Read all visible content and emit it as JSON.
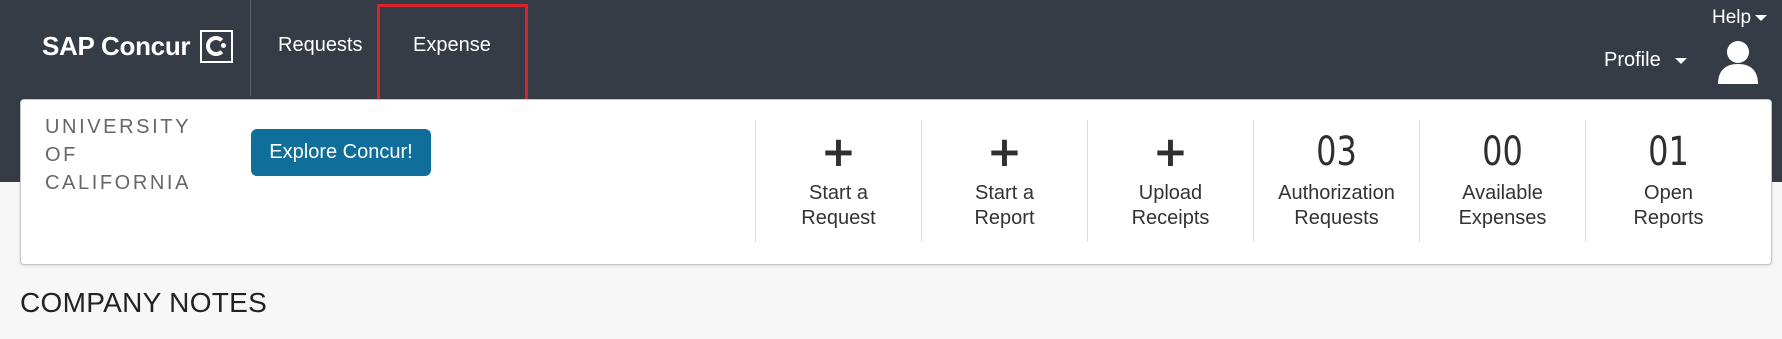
{
  "header": {
    "brand": "SAP Concur",
    "nav": [
      {
        "label": "Requests"
      },
      {
        "label": "Expense"
      }
    ],
    "help_label": "Help",
    "profile_label": "Profile",
    "highlight_color": "#d9232e",
    "background_color": "#353c45"
  },
  "org": {
    "logo_lines": [
      "UNIVERSITY",
      "OF",
      "CALIFORNIA"
    ]
  },
  "explore_button": {
    "label": "Explore Concur!",
    "color": "#0f6e9a"
  },
  "quick_tiles": [
    {
      "value": "+",
      "label_lines": [
        "Start a",
        "Request"
      ],
      "icon": "plus-icon"
    },
    {
      "value": "+",
      "label_lines": [
        "Start a",
        "Report"
      ],
      "icon": "plus-icon"
    },
    {
      "value": "+",
      "label_lines": [
        "Upload",
        "Receipts"
      ],
      "icon": "plus-icon"
    },
    {
      "value": "03",
      "label_lines": [
        "Authorization",
        "Requests"
      ]
    },
    {
      "value": "00",
      "label_lines": [
        "Available",
        "Expenses"
      ]
    },
    {
      "value": "01",
      "label_lines": [
        "Open",
        "Reports"
      ]
    }
  ],
  "section_title": "COMPANY NOTES"
}
